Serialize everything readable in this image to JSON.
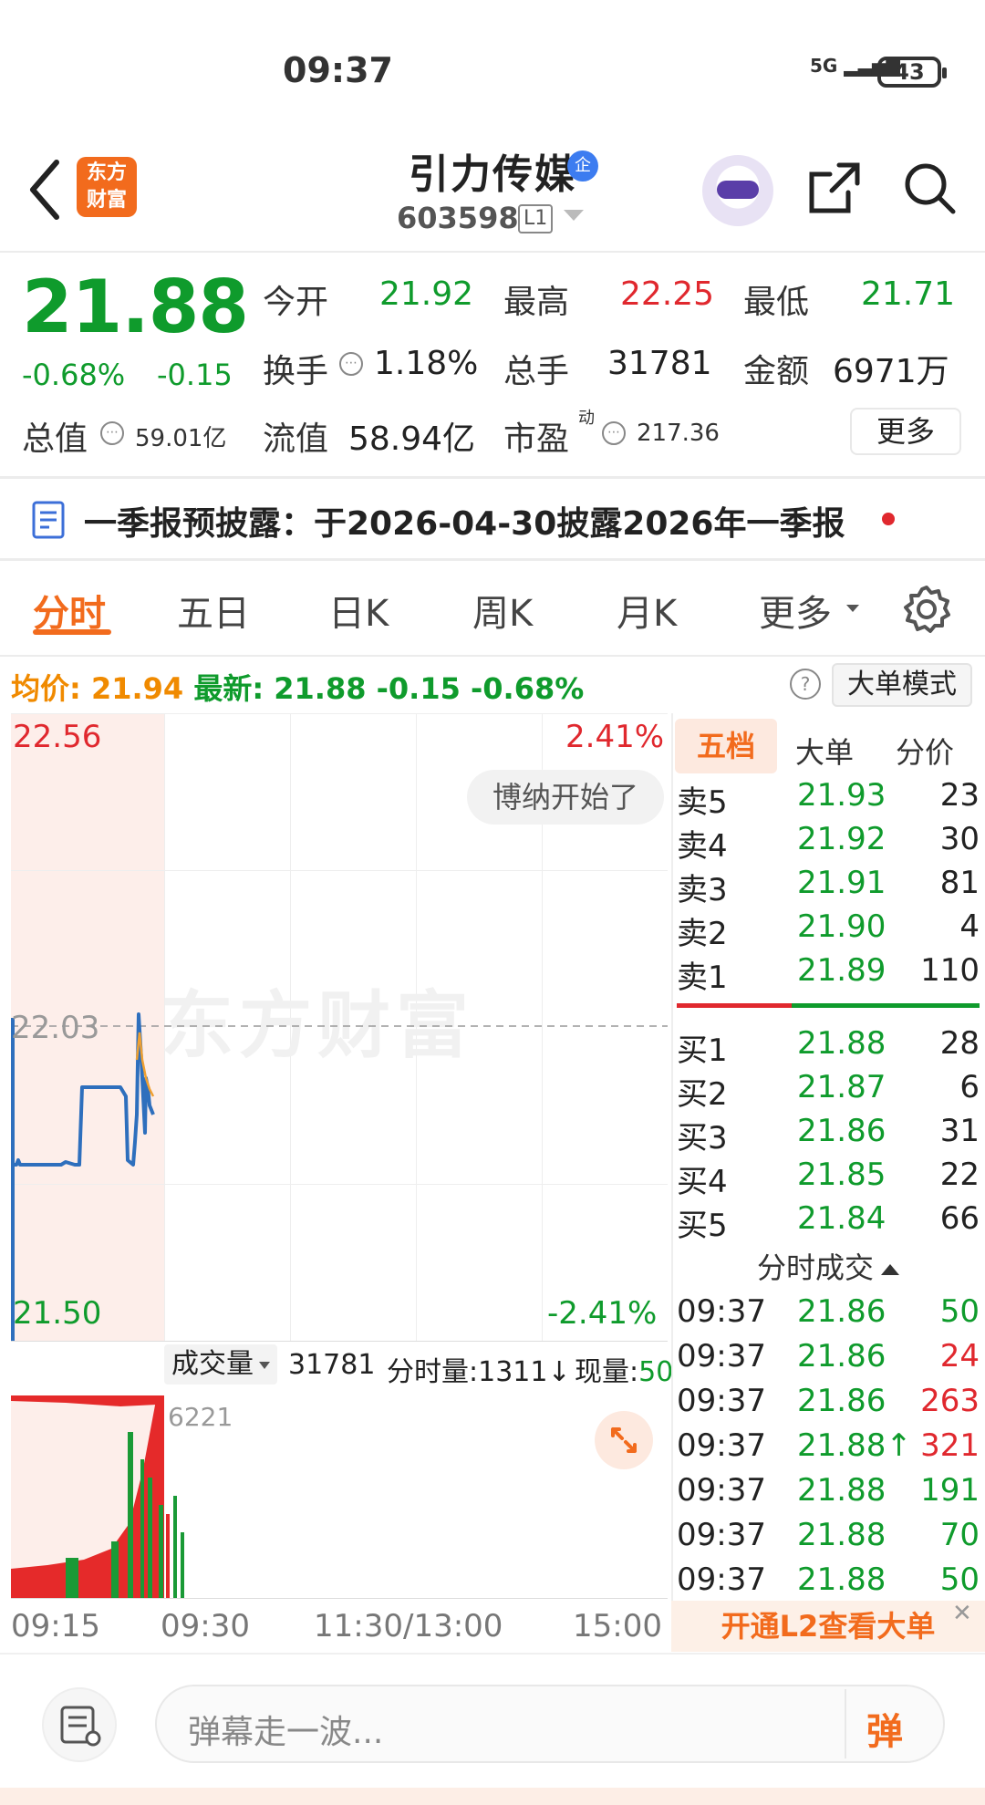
{
  "status": {
    "time": "09:37",
    "network": "5G",
    "battery": "43"
  },
  "header": {
    "logo_line1": "东方",
    "logo_line2": "财富",
    "stock_name": "引力传媒",
    "badge": "企",
    "stock_code": "603598",
    "level": "L1"
  },
  "quote": {
    "price": "21.88",
    "pct_change": "-0.68%",
    "abs_change": "-0.15",
    "open_label": "今开",
    "open": "21.92",
    "high_label": "最高",
    "high": "22.25",
    "low_label": "最低",
    "low": "21.71",
    "turnover_label": "换手",
    "turnover": "1.18%",
    "volume_label": "总手",
    "volume": "31781",
    "amount_label": "金额",
    "amount": "6971万",
    "total_value_label": "总值",
    "total_value": "59.01亿",
    "float_value_label": "流值",
    "float_value": "58.94亿",
    "pe_label": "市盈",
    "pe_sup": "动",
    "pe": "217.36",
    "more_label": "更多"
  },
  "notice": {
    "text": "一季报预披露：于2026-04-30披露2026年一季报"
  },
  "tabs": [
    "分时",
    "五日",
    "日K",
    "周K",
    "月K",
    "更多"
  ],
  "info_row": {
    "avg_label": "均价:",
    "avg": "21.94",
    "latest_label": "最新:",
    "latest": "21.88",
    "change": "-0.15",
    "pct": "-0.68%",
    "help": "?",
    "big_order_mode": "大单模式"
  },
  "chart": {
    "price_high": "22.56",
    "pct_high": "2.41%",
    "price_mid": "22.03",
    "price_low": "21.50",
    "pct_low": "-2.41%",
    "bullet": "博纳开始了",
    "watermark": "东方财富",
    "time_labels": [
      "09:15",
      "09:30",
      "11:30/13:00",
      "15:00"
    ]
  },
  "volume": {
    "selector": "成交量",
    "total": "31781",
    "minute_label": "分时量:",
    "minute": "1311↓",
    "now_label": "现量:",
    "now": "50",
    "peak": "6221"
  },
  "orderbook": {
    "tabs": [
      "五档",
      "大单",
      "分价"
    ],
    "asks": [
      {
        "label": "卖5",
        "price": "21.93",
        "qty": "23"
      },
      {
        "label": "卖4",
        "price": "21.92",
        "qty": "30"
      },
      {
        "label": "卖3",
        "price": "21.91",
        "qty": "81"
      },
      {
        "label": "卖2",
        "price": "21.90",
        "qty": "4"
      },
      {
        "label": "卖1",
        "price": "21.89",
        "qty": "110"
      }
    ],
    "bids": [
      {
        "label": "买1",
        "price": "21.88",
        "qty": "28"
      },
      {
        "label": "买2",
        "price": "21.87",
        "qty": "6"
      },
      {
        "label": "买3",
        "price": "21.86",
        "qty": "31"
      },
      {
        "label": "买4",
        "price": "21.85",
        "qty": "22"
      },
      {
        "label": "买5",
        "price": "21.84",
        "qty": "66"
      }
    ],
    "trades_header": "分时成交",
    "trades": [
      {
        "time": "09:37",
        "price": "21.86",
        "qty": "50",
        "color": "green"
      },
      {
        "time": "09:37",
        "price": "21.86",
        "qty": "24",
        "color": "red"
      },
      {
        "time": "09:37",
        "price": "21.86",
        "qty": "263",
        "color": "red"
      },
      {
        "time": "09:37",
        "price": "21.88↑",
        "qty": "321",
        "color": "red"
      },
      {
        "time": "09:37",
        "price": "21.88",
        "qty": "191",
        "color": "green"
      },
      {
        "time": "09:37",
        "price": "21.88",
        "qty": "70",
        "color": "green"
      },
      {
        "time": "09:37",
        "price": "21.88",
        "qty": "50",
        "color": "green"
      }
    ],
    "l2_banner": "开通L2查看大单",
    "l2_close": "✕"
  },
  "bottom": {
    "placeholder": "弹幕走一波...",
    "send": "弹"
  },
  "colors": {
    "up": "#e0282e",
    "down": "#0f9b2c",
    "accent": "#f26b1d",
    "avg": "#f08a00"
  }
}
